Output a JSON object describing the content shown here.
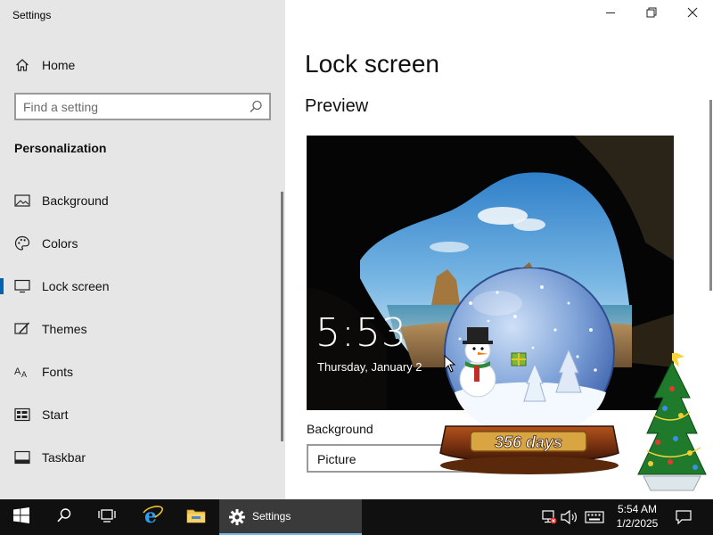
{
  "window": {
    "title": "Settings",
    "controls": [
      "minimize-icon",
      "restore-icon",
      "close-icon"
    ]
  },
  "nav": {
    "home_label": "Home",
    "search_placeholder": "Find a setting",
    "section_title": "Personalization",
    "items": [
      {
        "label": "Background",
        "icon": "picture-icon",
        "selected": false
      },
      {
        "label": "Colors",
        "icon": "palette-icon",
        "selected": false
      },
      {
        "label": "Lock screen",
        "icon": "monitor-icon",
        "selected": true
      },
      {
        "label": "Themes",
        "icon": "brush-icon",
        "selected": false
      },
      {
        "label": "Fonts",
        "icon": "font-icon",
        "selected": false
      },
      {
        "label": "Start",
        "icon": "start-icon",
        "selected": false
      },
      {
        "label": "Taskbar",
        "icon": "taskbar-icon",
        "selected": false
      }
    ]
  },
  "main": {
    "title": "Lock screen",
    "preview_heading": "Preview",
    "preview_time": "5:53",
    "preview_date": "Thursday, January 2",
    "background_label": "Background",
    "background_value": "Picture"
  },
  "gadget": {
    "days_text": "356 days"
  },
  "taskbar": {
    "settings_label": "Settings",
    "clock_time": "5:54 AM",
    "clock_date": "1/2/2025",
    "pinned": [
      "start-icon",
      "search-icon",
      "task-view-icon",
      "internet-explorer-icon",
      "file-explorer-icon"
    ],
    "tray": [
      "network-disconnected-icon",
      "volume-icon",
      "keyboard-icon",
      "notification-icon"
    ]
  },
  "colors": {
    "accent": "#0063b1",
    "nav_bg": "#e6e6e6",
    "taskbar_bg": "#101010"
  }
}
